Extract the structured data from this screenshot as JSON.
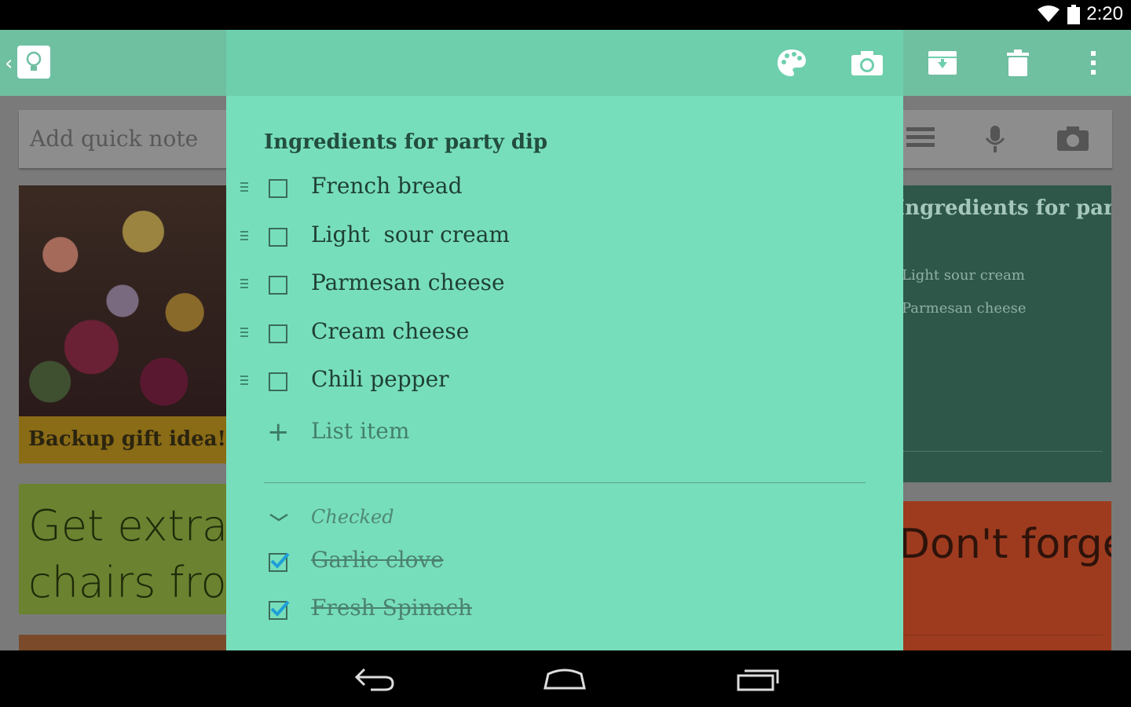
{
  "status_bar": {
    "time": "2:20",
    "icons": [
      "wifi-icon",
      "battery-icon"
    ]
  },
  "background": {
    "quick_note_placeholder": "Add quick note",
    "photo_card_title": "Backup gift idea!",
    "green_card_text": "Get extra chairs from attic",
    "teal_card_title": "Ingredients for party dip",
    "teal_card_lines": [
      "Light sour cream",
      "Parmesan cheese"
    ],
    "red_card_text": "Don't forget to buy balloons"
  },
  "toolbar": {
    "icons": [
      "palette-icon",
      "camera-icon",
      "archive-icon",
      "trash-icon",
      "overflow-menu-icon"
    ]
  },
  "note": {
    "title": "Ingredients for party dip",
    "items": [
      {
        "text": "French bread",
        "checked": false
      },
      {
        "text": "Light  sour cream",
        "checked": false
      },
      {
        "text": "Parmesan cheese",
        "checked": false
      },
      {
        "text": "Cream cheese",
        "checked": false
      },
      {
        "text": "Chili pepper",
        "checked": false
      }
    ],
    "add_item_placeholder": "List item",
    "checked_section_label": "Checked",
    "checked_items": [
      {
        "text": "Garlic clove",
        "checked": true
      },
      {
        "text": "Fresh Spinach",
        "checked": true
      }
    ]
  },
  "colors": {
    "note_bg": "#77debb",
    "toolbar": "#6ecfad",
    "check_accent": "#1e9fd8"
  },
  "nav_bar": {
    "buttons": [
      "back-icon",
      "home-icon",
      "recents-icon"
    ]
  }
}
